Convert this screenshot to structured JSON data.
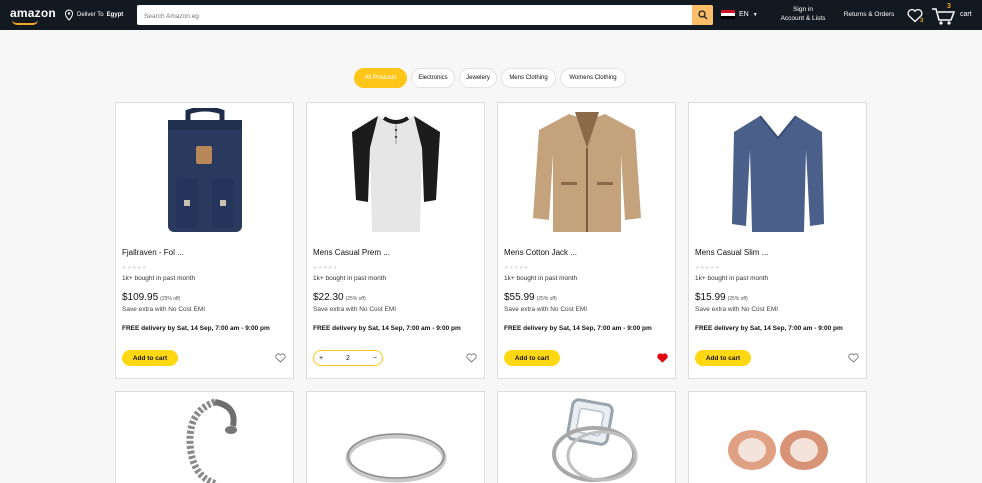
{
  "header": {
    "logo": "amazon",
    "deliver_prefix": "Deliver To",
    "deliver_location": "Egypt",
    "search_placeholder": "Search Amazon.eg",
    "language": "EN",
    "signin_line1": "Sign in",
    "signin_line2": "Account & Lists",
    "returns": "Returns & Orders",
    "wishlist_count": "3",
    "cart_count": "3",
    "cart_label": "cart",
    "colors": {
      "bg": "#131921",
      "accent": "#febd69"
    }
  },
  "categories": [
    {
      "label": "All Products",
      "active": true
    },
    {
      "label": "Electronics",
      "active": false
    },
    {
      "label": "Jewelery",
      "active": false
    },
    {
      "label": "Mens Clothing",
      "active": false
    },
    {
      "label": "Womens Clothing",
      "active": false
    }
  ],
  "products": [
    {
      "title": "Fjallraven - Fol ...",
      "bought": "1k+ bought in past month",
      "price": "$109.95",
      "discount": "(25% off)",
      "emi": "Save extra with No Cost EMI",
      "delivery": "FREE delivery by Sat, 14 Sep, 7:00 am - 9:00 pm",
      "action": "Add to cart",
      "image_icon": "backpack-icon",
      "wishlisted": false
    },
    {
      "title": "Mens Casual Prem ...",
      "bought": "1k+ bought in past month",
      "price": "$22.30",
      "discount": "(25% off)",
      "emi": "Save extra with No Cost EMI",
      "delivery": "FREE delivery by Sat, 14 Sep, 7:00 am - 9:00 pm",
      "action": "stepper",
      "quantity": "2",
      "image_icon": "tshirt-icon",
      "wishlisted": false
    },
    {
      "title": "Mens Cotton Jack ...",
      "bought": "1k+ bought in past month",
      "price": "$55.99",
      "discount": "(25% off)",
      "emi": "Save extra with No Cost EMI",
      "delivery": "FREE delivery by Sat, 14 Sep, 7:00 am - 9:00 pm",
      "action": "Add to cart",
      "image_icon": "jacket-icon",
      "wishlisted": true
    },
    {
      "title": "Mens Casual Slim ...",
      "bought": "1k+ bought in past month",
      "price": "$15.99",
      "discount": "(25% off)",
      "emi": "Save extra with No Cost EMI",
      "delivery": "FREE delivery by Sat, 14 Sep, 7:00 am - 9:00 pm",
      "action": "Add to cart",
      "image_icon": "sweater-icon",
      "wishlisted": false
    }
  ],
  "row2_images": [
    "bracelet-icon",
    "ring-icon",
    "diamond-ring-icon",
    "earrings-icon"
  ],
  "stepper": {
    "minus": "−",
    "plus": "+"
  }
}
